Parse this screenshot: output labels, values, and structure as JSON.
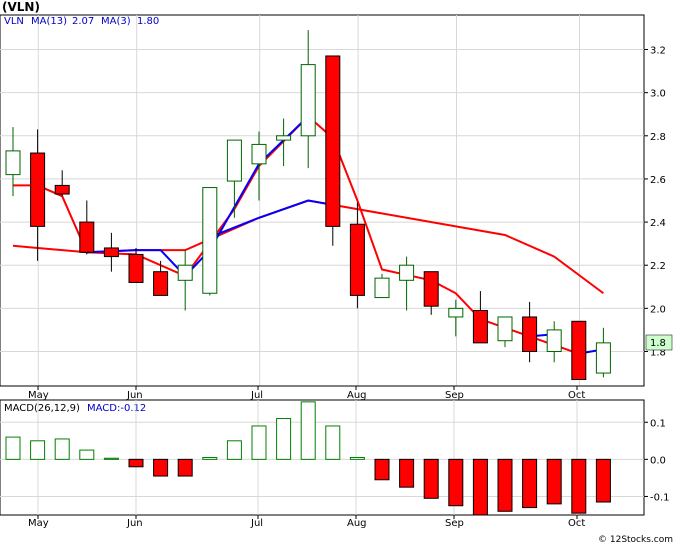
{
  "chart_data": [
    {
      "type": "candlestick",
      "title": "(VLN)",
      "legend": {
        "symbol": "VLN",
        "ma13_label": "MA(13)",
        "ma13_value": "2.07",
        "ma3_label": "MA(3)",
        "ma3_value": "1.80",
        "ma13_color": "#ff0000",
        "ma3_color": "#0000ff"
      },
      "last_price_label": "1.8",
      "y_ticks": [
        "1.8",
        "2.0",
        "2.2",
        "2.4",
        "2.6",
        "2.8",
        "3.0",
        "3.2"
      ],
      "ylim": [
        1.64,
        3.36
      ],
      "months": [
        "May",
        "Jun",
        "Jul",
        "Aug",
        "Sep",
        "Oct"
      ],
      "candles": [
        {
          "o": 2.62,
          "h": 2.84,
          "l": 2.52,
          "c": 2.73
        },
        {
          "o": 2.72,
          "h": 2.83,
          "l": 2.22,
          "c": 2.38
        },
        {
          "o": 2.57,
          "h": 2.64,
          "l": 2.52,
          "c": 2.53
        },
        {
          "o": 2.4,
          "h": 2.5,
          "l": 2.25,
          "c": 2.26
        },
        {
          "o": 2.28,
          "h": 2.35,
          "l": 2.17,
          "c": 2.24
        },
        {
          "o": 2.25,
          "h": 2.28,
          "l": 2.16,
          "c": 2.12
        },
        {
          "o": 2.17,
          "h": 2.22,
          "l": 2.06,
          "c": 2.06
        },
        {
          "o": 2.13,
          "h": 2.27,
          "l": 1.99,
          "c": 2.2
        },
        {
          "o": 2.07,
          "h": 2.48,
          "l": 2.06,
          "c": 2.56
        },
        {
          "o": 2.59,
          "h": 2.73,
          "l": 2.42,
          "c": 2.78
        },
        {
          "o": 2.67,
          "h": 2.82,
          "l": 2.5,
          "c": 2.76
        },
        {
          "o": 2.78,
          "h": 2.88,
          "l": 2.66,
          "c": 2.8
        },
        {
          "o": 2.8,
          "h": 3.29,
          "l": 2.65,
          "c": 3.13
        },
        {
          "o": 3.17,
          "h": 3.17,
          "l": 2.29,
          "c": 2.38
        },
        {
          "o": 2.39,
          "h": 2.49,
          "l": 2.0,
          "c": 2.06
        },
        {
          "o": 2.05,
          "h": 2.16,
          "l": 2.05,
          "c": 2.14
        },
        {
          "o": 2.13,
          "h": 2.24,
          "l": 1.99,
          "c": 2.2
        },
        {
          "o": 2.17,
          "h": 2.17,
          "l": 1.97,
          "c": 2.01
        },
        {
          "o": 1.96,
          "h": 2.04,
          "l": 1.87,
          "c": 2.0
        },
        {
          "o": 1.99,
          "h": 2.08,
          "l": 1.84,
          "c": 1.84
        },
        {
          "o": 1.85,
          "h": 1.95,
          "l": 1.82,
          "c": 1.96
        },
        {
          "o": 1.96,
          "h": 2.03,
          "l": 1.75,
          "c": 1.8
        },
        {
          "o": 1.8,
          "h": 1.94,
          "l": 1.75,
          "c": 1.9
        },
        {
          "o": 1.94,
          "h": 1.94,
          "l": 1.67,
          "c": 1.67
        },
        {
          "o": 1.7,
          "h": 1.91,
          "l": 1.68,
          "c": 1.84
        }
      ],
      "ma3": [
        null,
        null,
        null,
        null,
        null,
        null,
        null,
        null,
        2.26,
        2.27,
        2.27,
        2.15,
        2.27,
        2.67,
        2.9
      ],
      "ma13": [
        2.29,
        2.28,
        2.34,
        2.42,
        2.46,
        2.5,
        2.48,
        2.46,
        2.42,
        2.38,
        2.34,
        2.24,
        2.07
      ],
      "month_start_index": [
        1,
        5,
        10,
        14,
        18,
        23
      ]
    },
    {
      "type": "bar",
      "title": "MACD(26,12,9)",
      "label_macd": "MACD(26,12,9)",
      "label_value": "MACD:-0.12",
      "y_ticks": [
        "0.1",
        "0.0",
        "-0.1"
      ],
      "ylim": [
        -0.15,
        0.16
      ],
      "months": [
        "May",
        "Jun",
        "Jul",
        "Aug",
        "Sep",
        "Oct"
      ],
      "values": [
        0.06,
        0.05,
        0.055,
        0.025,
        0.003,
        -0.02,
        -0.045,
        -0.045,
        0.005,
        0.05,
        0.09,
        0.11,
        0.155,
        0.09,
        0.005,
        -0.055,
        -0.075,
        -0.105,
        -0.125,
        -0.15,
        -0.14,
        -0.13,
        -0.12,
        -0.145,
        -0.115
      ],
      "positive_color": "#008000",
      "negative_color": "#ff0000"
    }
  ],
  "watermark": "© 12Stocks.com"
}
